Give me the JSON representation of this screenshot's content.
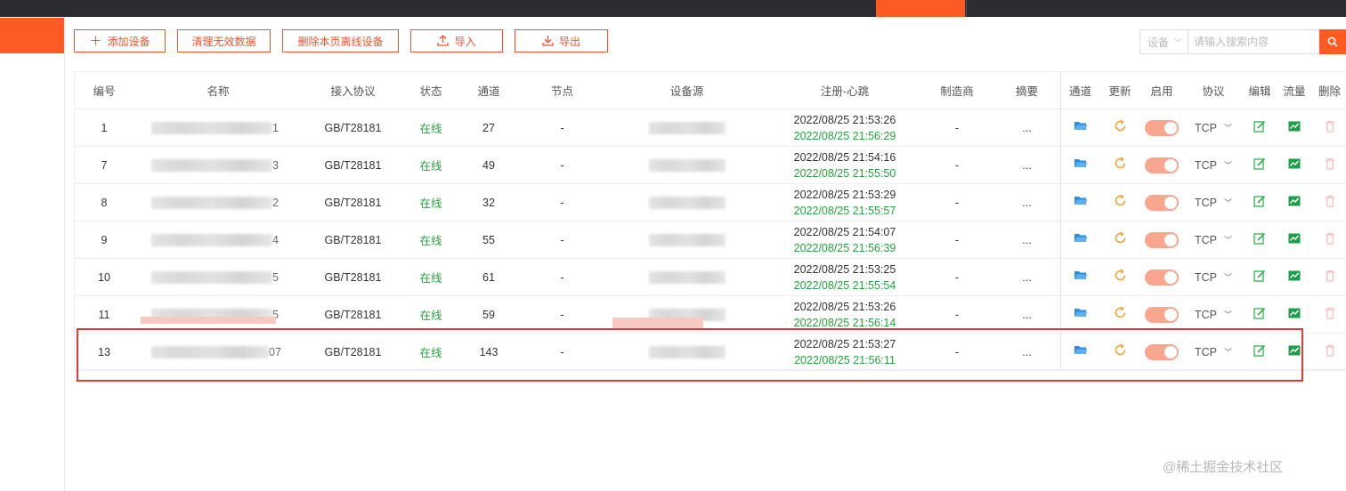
{
  "toolbar": {
    "add_label": "添加设备",
    "clean_label": "清理无效数据",
    "delete_offline_label": "删除本页离线设备",
    "import_label": "导入",
    "export_label": "导出"
  },
  "search": {
    "select_value": "设备",
    "placeholder": "请输入搜索内容"
  },
  "table": {
    "columns": [
      "编号",
      "名称",
      "接入协议",
      "状态",
      "通道",
      "节点",
      "设备源",
      "注册-心跳",
      "制造商",
      "摘要",
      "通道",
      "更新",
      "启用",
      "协议",
      "编辑",
      "流量",
      "删除"
    ],
    "rows": [
      {
        "id": "1",
        "name_tail": "1",
        "protocol": "GB/T28181",
        "status": "在线",
        "channels": "27",
        "node": "-",
        "register": "2022/08/25 21:53:26",
        "heartbeat": "2022/08/25 21:56:29",
        "maker": "-",
        "summary": "...",
        "transport": "TCP"
      },
      {
        "id": "7",
        "name_tail": "3",
        "protocol": "GB/T28181",
        "status": "在线",
        "channels": "49",
        "node": "-",
        "register": "2022/08/25 21:54:16",
        "heartbeat": "2022/08/25 21:55:50",
        "maker": "-",
        "summary": "...",
        "transport": "TCP"
      },
      {
        "id": "8",
        "name_tail": "2",
        "protocol": "GB/T28181",
        "status": "在线",
        "channels": "32",
        "node": "-",
        "register": "2022/08/25 21:53:29",
        "heartbeat": "2022/08/25 21:55:57",
        "maker": "-",
        "summary": "...",
        "transport": "TCP"
      },
      {
        "id": "9",
        "name_tail": "4",
        "protocol": "GB/T28181",
        "status": "在线",
        "channels": "55",
        "node": "-",
        "register": "2022/08/25 21:54:07",
        "heartbeat": "2022/08/25 21:56:39",
        "maker": "-",
        "summary": "...",
        "transport": "TCP"
      },
      {
        "id": "10",
        "name_tail": "5",
        "protocol": "GB/T28181",
        "status": "在线",
        "channels": "61",
        "node": "-",
        "register": "2022/08/25 21:53:25",
        "heartbeat": "2022/08/25 21:55:54",
        "maker": "-",
        "summary": "...",
        "transport": "TCP"
      },
      {
        "id": "11",
        "name_tail": "5",
        "protocol": "GB/T28181",
        "status": "在线",
        "channels": "59",
        "node": "-",
        "register": "2022/08/25 21:53:26",
        "heartbeat": "2022/08/25 21:56:14",
        "maker": "-",
        "summary": "...",
        "transport": "TCP"
      },
      {
        "id": "13",
        "name_tail": "07",
        "protocol": "GB/T28181",
        "status": "在线",
        "channels": "143",
        "node": "-",
        "register": "2022/08/25 21:53:27",
        "heartbeat": "2022/08/25 21:56:11",
        "maker": "-",
        "summary": "...",
        "transport": "TCP"
      }
    ]
  },
  "watermark": "@稀土掘金技术社区",
  "colors": {
    "accent": "#fe5a24",
    "online": "#24a43a",
    "highlight": "#e03b35"
  }
}
